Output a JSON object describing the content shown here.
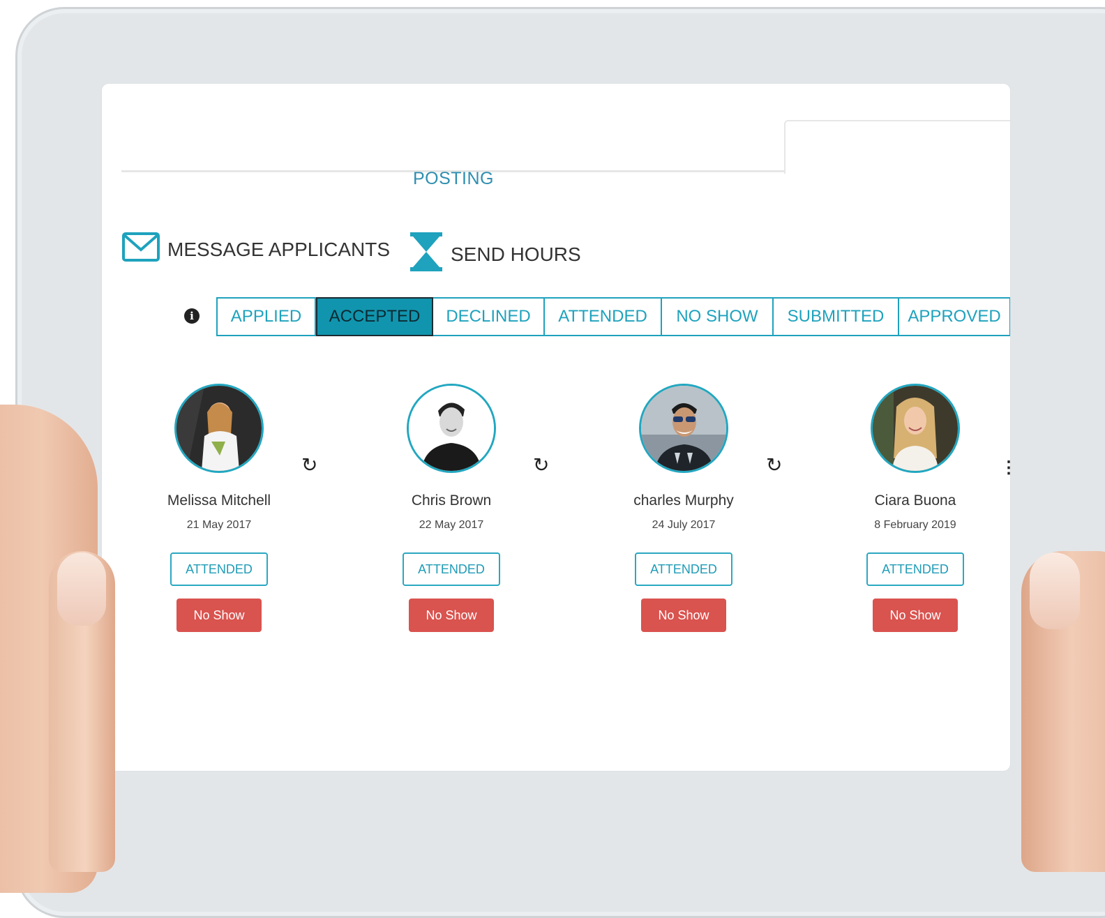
{
  "header": {
    "posting_tab": "POSTING"
  },
  "actions": {
    "message_applicants": "MESSAGE APPLICANTS",
    "send_hours": "SEND HOURS"
  },
  "status_tabs": [
    {
      "label": "APPLIED",
      "active": false
    },
    {
      "label": "ACCEPTED",
      "active": true
    },
    {
      "label": "DECLINED",
      "active": false
    },
    {
      "label": "ATTENDED",
      "active": false
    },
    {
      "label": "NO SHOW",
      "active": false
    },
    {
      "label": "SUBMITTED",
      "active": false
    },
    {
      "label": "APPROVED",
      "active": false
    }
  ],
  "applicants": [
    {
      "name": "Melissa Mitchell",
      "date": "21 May 2017",
      "attended_label": "ATTENDED",
      "noshow_label": "No Show"
    },
    {
      "name": "Chris Brown",
      "date": "22 May 2017",
      "attended_label": "ATTENDED",
      "noshow_label": "No Show"
    },
    {
      "name": "charles Murphy",
      "date": "24 July 2017",
      "attended_label": "ATTENDED",
      "noshow_label": "No Show"
    },
    {
      "name": "Ciara Buona",
      "date": "8 February 2019",
      "attended_label": "ATTENDED",
      "noshow_label": "No Show"
    }
  ],
  "colors": {
    "accent": "#1ea2bd",
    "active_tab": "#1195ae",
    "danger": "#d9534f"
  },
  "icons": {
    "message": "envelope-icon",
    "hours": "hourglass-icon",
    "info": "info-icon",
    "undo": "refresh-icon"
  }
}
